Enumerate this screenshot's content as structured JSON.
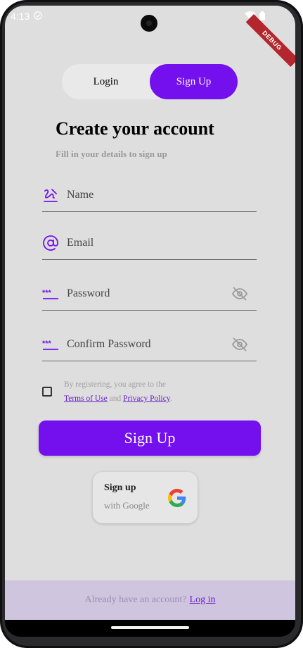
{
  "status_bar": {
    "time": "4:13",
    "debug_label": "DEBUG"
  },
  "toggle": {
    "login_label": "Login",
    "signup_label": "Sign Up",
    "active": "Sign Up"
  },
  "header": {
    "title": "Create your account",
    "subtitle": "Fill in your details to sign up"
  },
  "form": {
    "name_label": "Name",
    "email_label": "Email",
    "password_label": "Password",
    "confirm_label": "Confirm Password",
    "password_icon_text": "***"
  },
  "terms": {
    "prefix": "By registering, you agree to the",
    "terms_link": "Terms of Use",
    "and": "and",
    "privacy_link": "Privacy Policy",
    "period": ".",
    "checked": false
  },
  "actions": {
    "signup_button": "Sign Up",
    "google_title": "Sign up",
    "google_sub": "with Google"
  },
  "footer": {
    "text": "Already have an account?",
    "link": "Log in"
  },
  "colors": {
    "accent": "#7410ee",
    "background": "#dedede",
    "footer_bg": "#d0c5df"
  }
}
